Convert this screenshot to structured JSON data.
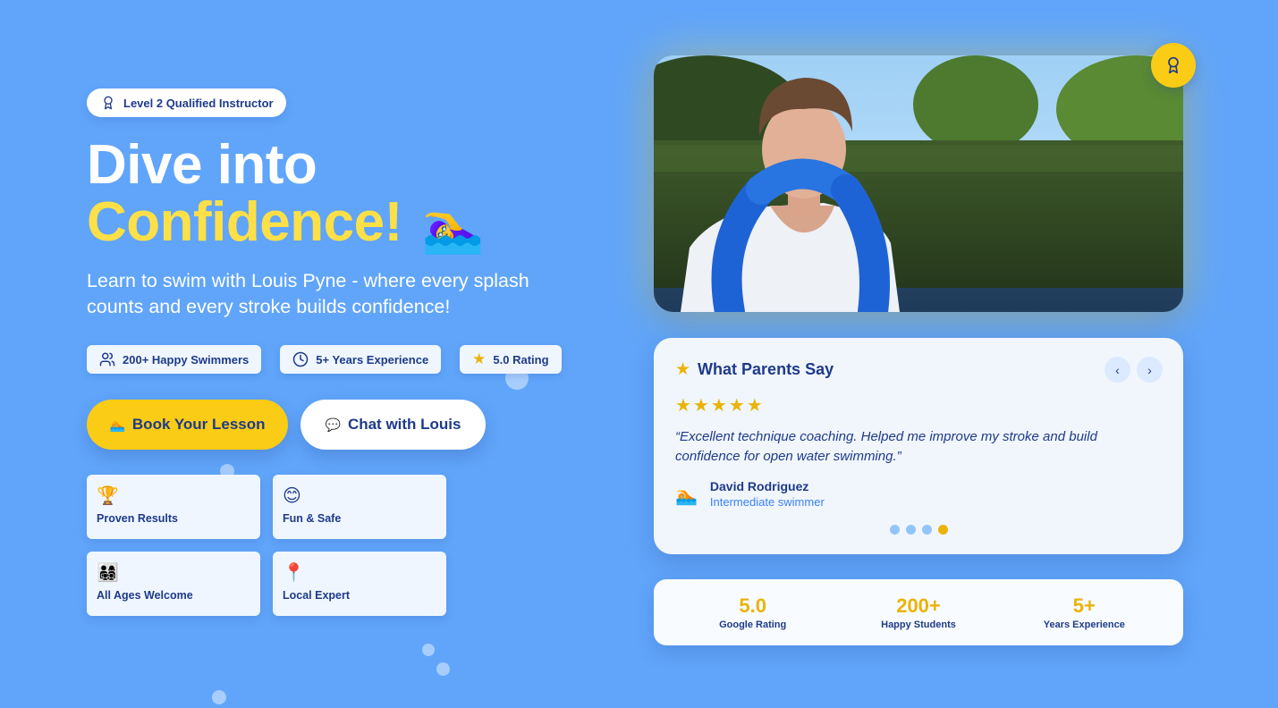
{
  "hero": {
    "badge_label": "Level 2 Qualified Instructor",
    "headline_line1": "Dive into",
    "headline_line2": "Confidence!",
    "headline_emoji": "🏊‍♀️",
    "subtitle": "Learn to swim with Louis Pyne - where every splash counts and every stroke builds confidence!",
    "stats": [
      {
        "icon": "users-icon",
        "label": "200+ Happy Swimmers"
      },
      {
        "icon": "clock-icon",
        "label": "5+ Years Experience"
      },
      {
        "icon": "star-icon",
        "label": "5.0 Rating"
      }
    ],
    "cta_primary": {
      "icon": "🏊",
      "label": "Book Your Lesson"
    },
    "cta_secondary": {
      "icon": "💬",
      "label": "Chat with Louis"
    },
    "features": [
      {
        "icon": "🏆",
        "label": "Proven Results"
      },
      {
        "icon": "😊",
        "label": "Fun & Safe"
      },
      {
        "icon": "👨‍👩‍👧‍👦",
        "label": "All Ages Welcome"
      },
      {
        "icon": "📍",
        "label": "Local Expert"
      }
    ]
  },
  "photo": {
    "award_icon": "award-icon"
  },
  "testimonial": {
    "title": "What Parents Say",
    "stars": "★★★★★",
    "quote": "“Excellent technique coaching. Helped me improve my stroke and build confidence for open water swimming.”",
    "author_icon": "🏊",
    "author_name": "David Rodriguez",
    "author_role": "Intermediate swimmer",
    "prev_label": "‹",
    "next_label": "›",
    "dot_count": 4,
    "active_dot": 4
  },
  "metrics": [
    {
      "value": "5.0",
      "label": "Google Rating"
    },
    {
      "value": "200+",
      "label": "Happy Students"
    },
    {
      "value": "5+",
      "label": "Years Experience"
    }
  ],
  "colors": {
    "background": "#60a5fa",
    "accent_yellow": "#facc15",
    "text_navy": "#1e3a8a"
  }
}
